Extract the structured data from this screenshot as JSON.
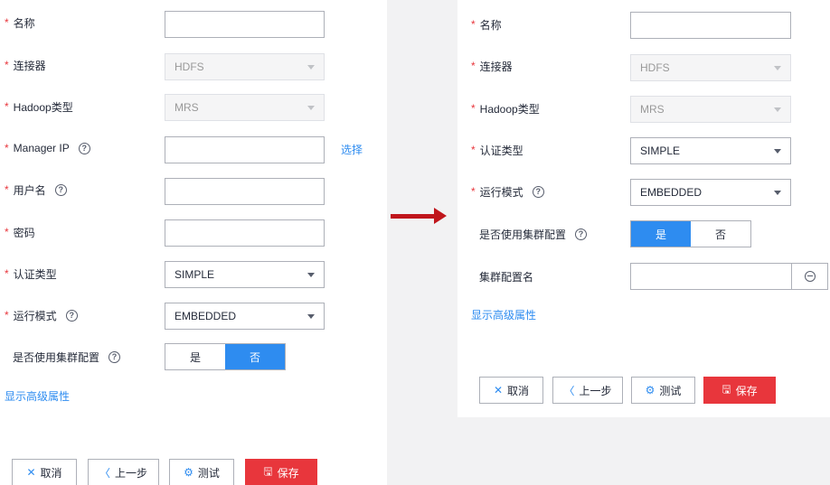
{
  "left": {
    "fields": {
      "name_label": "名称",
      "connector_label": "连接器",
      "connector_value": "HDFS",
      "hadoop_type_label": "Hadoop类型",
      "hadoop_type_value": "MRS",
      "manager_ip_label": "Manager IP",
      "manager_ip_select_link": "选择",
      "username_label": "用户名",
      "password_label": "密码",
      "auth_type_label": "认证类型",
      "auth_type_value": "SIMPLE",
      "run_mode_label": "运行模式",
      "run_mode_value": "EMBEDDED",
      "use_cluster_config_label": "是否使用集群配置",
      "yes": "是",
      "no": "否"
    },
    "show_advanced_link": "显示高级属性",
    "buttons": {
      "cancel": "取消",
      "prev": "上一步",
      "test": "测试",
      "save": "保存"
    }
  },
  "right": {
    "fields": {
      "name_label": "名称",
      "connector_label": "连接器",
      "connector_value": "HDFS",
      "hadoop_type_label": "Hadoop类型",
      "hadoop_type_value": "MRS",
      "auth_type_label": "认证类型",
      "auth_type_value": "SIMPLE",
      "run_mode_label": "运行模式",
      "run_mode_value": "EMBEDDED",
      "use_cluster_config_label": "是否使用集群配置",
      "yes": "是",
      "no": "否",
      "cluster_config_name_label": "集群配置名"
    },
    "show_advanced_link": "显示高级属性",
    "buttons": {
      "cancel": "取消",
      "prev": "上一步",
      "test": "测试",
      "save": "保存"
    }
  },
  "icons": {
    "required_mark": "*",
    "help_glyph": "?",
    "cancel_glyph": "✕",
    "prev_glyph": "〈",
    "test_glyph": "⚙",
    "save_glyph": "🖫"
  },
  "colors": {
    "accent_blue": "#2e8cf0",
    "save_red": "#e8363c",
    "arrow_red": "#c0161c",
    "required_red": "#e8363c"
  }
}
